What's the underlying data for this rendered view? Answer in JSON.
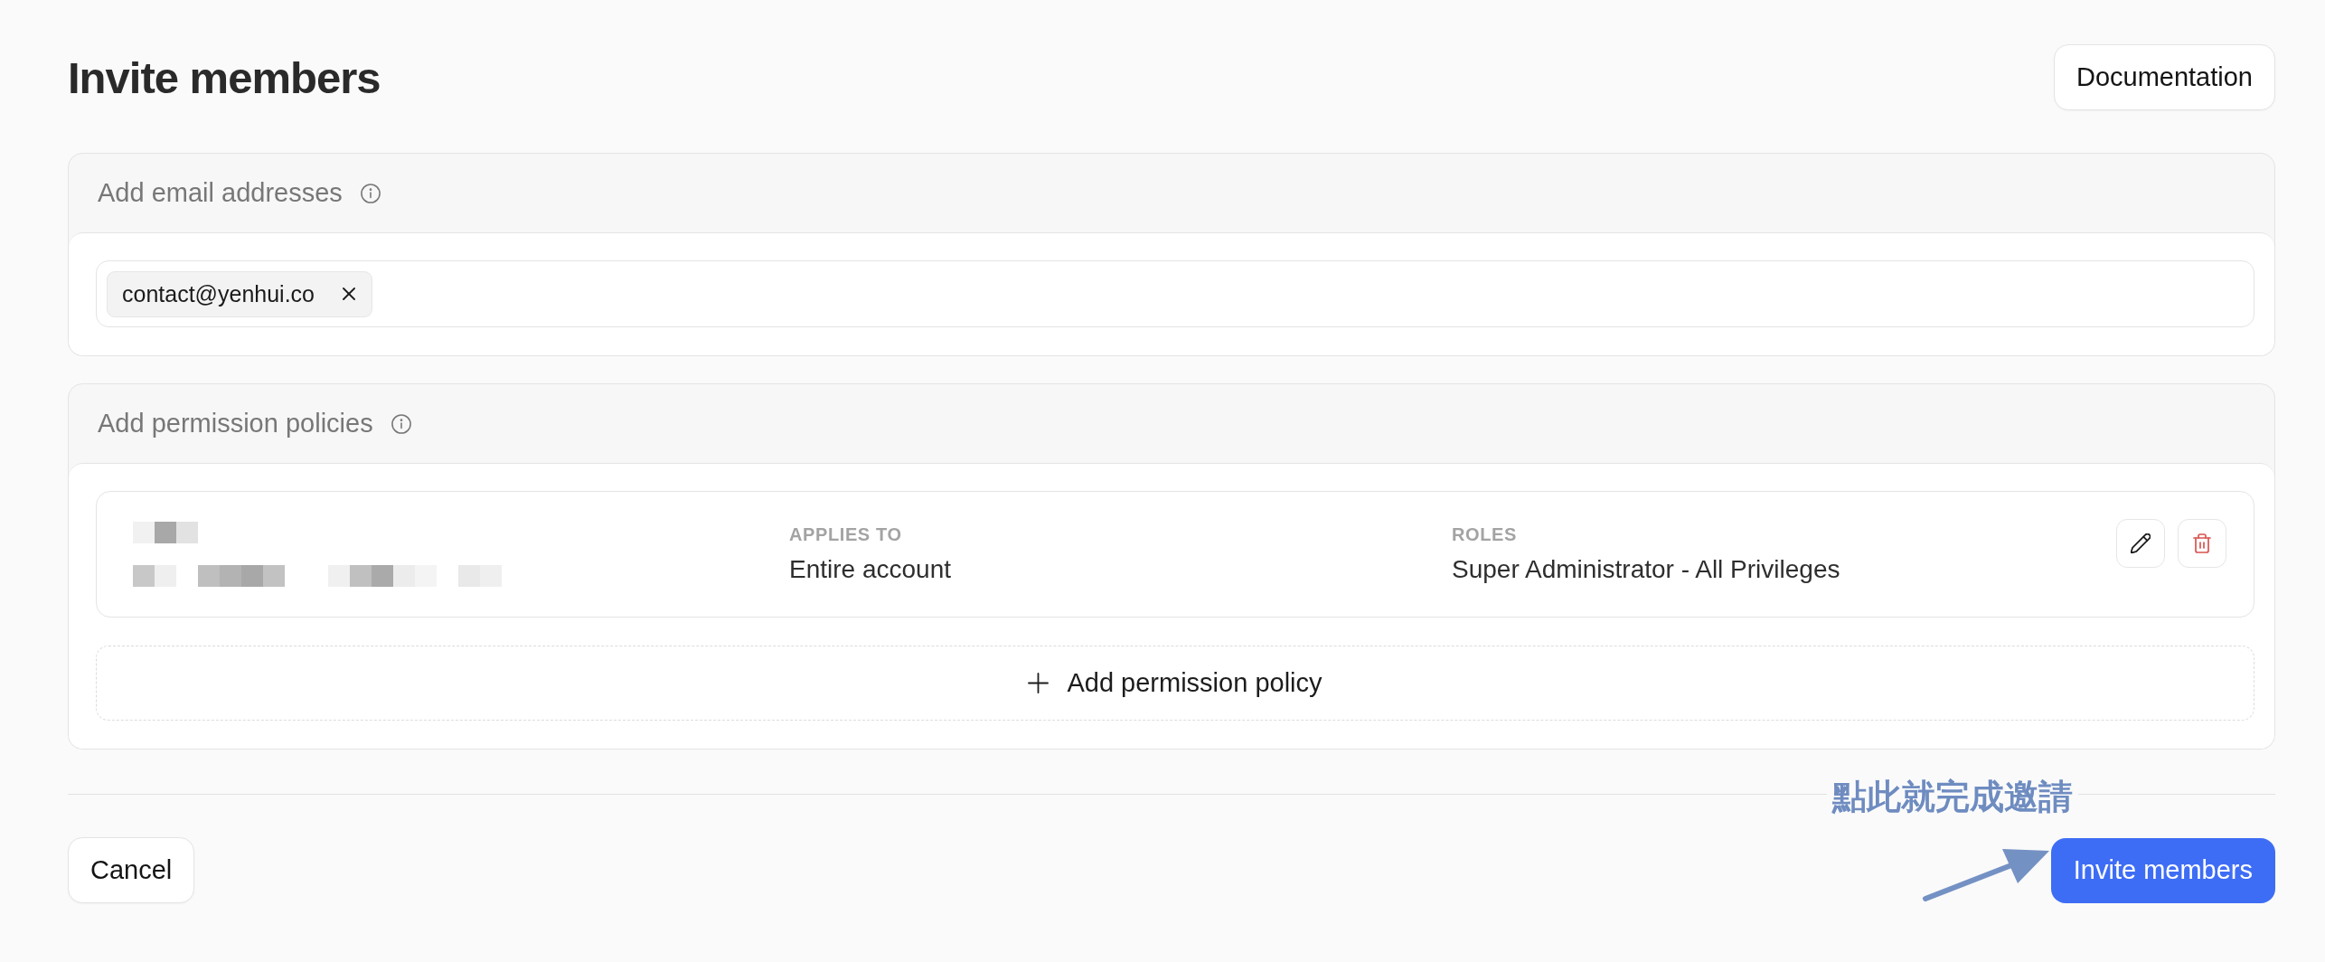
{
  "header": {
    "title": "Invite members",
    "documentation_button": "Documentation"
  },
  "email_section": {
    "heading": "Add email addresses",
    "emails": [
      "contact@yenhui.co"
    ]
  },
  "permission_section": {
    "heading": "Add permission policies",
    "policies": [
      {
        "applies_to_label": "APPLIES TO",
        "applies_to": "Entire account",
        "roles_label": "ROLES",
        "roles": "Super Administrator - All Privileges"
      }
    ],
    "add_button": "Add permission policy"
  },
  "footer": {
    "cancel_button": "Cancel",
    "submit_button": "Invite members"
  },
  "annotation": {
    "text": "點此就完成邀請"
  }
}
